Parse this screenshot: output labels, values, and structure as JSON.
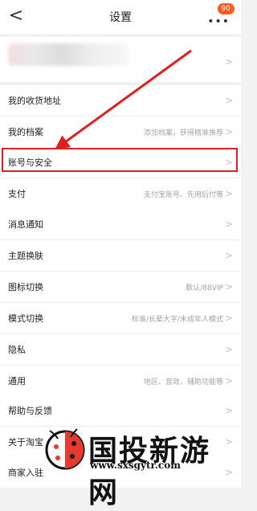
{
  "header": {
    "back_icon": "<",
    "title": "设置",
    "more_icon": "•••",
    "badge": "90"
  },
  "profile": {
    "chevron": ">"
  },
  "sections": [
    {
      "rows": [
        {
          "label": "我的收货地址",
          "hint": ""
        },
        {
          "label": "我的档案",
          "hint": "添加档案，获得精准推荐"
        }
      ]
    },
    {
      "rows": [
        {
          "label": "账号与安全",
          "hint": ""
        },
        {
          "label": "支付",
          "hint": "支付宝账号、先用后付等"
        }
      ]
    },
    {
      "rows": [
        {
          "label": "消息通知",
          "hint": ""
        },
        {
          "label": "主题换肤",
          "hint": ""
        },
        {
          "label": "图标切换",
          "hint": "默认/88VIP"
        },
        {
          "label": "模式切换",
          "hint": "标准/长辈大字/未成年人模式"
        },
        {
          "label": "隐私",
          "hint": ""
        },
        {
          "label": "通用",
          "hint": "地区、音效、辅助功能等"
        }
      ]
    },
    {
      "rows": [
        {
          "label": "帮助与反馈",
          "hint": ""
        },
        {
          "label": "关于淘宝",
          "hint": ""
        }
      ]
    },
    {
      "rows": [
        {
          "label": "商家入驻",
          "hint": ""
        }
      ]
    }
  ],
  "chevron": ">",
  "annotation": {
    "highlight_color": "#e02020",
    "arrow_color": "#e02020"
  },
  "watermark": {
    "text": "国投新游网",
    "url": "www.sxsgytr.com"
  }
}
